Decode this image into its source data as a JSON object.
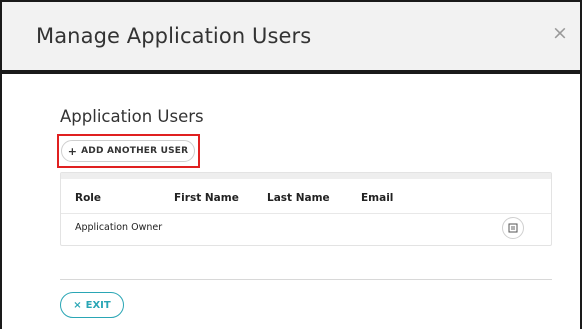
{
  "modal": {
    "title": "Manage Application Users",
    "close_icon": "close-icon",
    "close_glyph": "×"
  },
  "section": {
    "title": "Application Users"
  },
  "add_button": {
    "icon": "plus-icon",
    "glyph": "+",
    "label": "ADD ANOTHER USER"
  },
  "table": {
    "columns": [
      "Role",
      "First Name",
      "Last Name",
      "Email"
    ],
    "rows": [
      {
        "role": "Application Owner",
        "first_name": "",
        "last_name": "",
        "email": "",
        "action_icon": "edit-icon"
      }
    ]
  },
  "exit_button": {
    "icon": "x-icon",
    "glyph": "×",
    "label": "EXIT"
  },
  "colors": {
    "accent": "#2aa6b5",
    "highlight": "#e02020",
    "header_bg": "#f2f2f2"
  }
}
